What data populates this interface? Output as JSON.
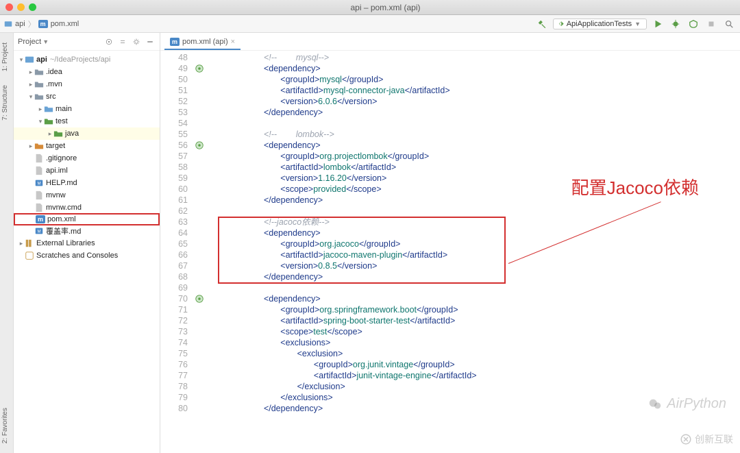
{
  "window": {
    "title": "api – pom.xml (api)"
  },
  "breadcrumb": {
    "project": "api",
    "file": "pom.xml"
  },
  "toolbar": {
    "run_config": "ApiApplicationTests",
    "hammer_title": "Build",
    "run_title": "Run",
    "debug_title": "Debug",
    "coverage_title": "Coverage",
    "stop_title": "Stop",
    "search_title": "Search"
  },
  "rail": {
    "project": "1: Project",
    "structure": "7: Structure",
    "favorites": "2: Favorites"
  },
  "sidebar": {
    "title": "Project",
    "items": [
      {
        "depth": 0,
        "tw": "▾",
        "icon": "module",
        "label": "api",
        "path": "~/IdeaProjects/api",
        "bold": true
      },
      {
        "depth": 1,
        "tw": "▸",
        "icon": "folder",
        "label": ".idea"
      },
      {
        "depth": 1,
        "tw": "▸",
        "icon": "folder",
        "label": ".mvn"
      },
      {
        "depth": 1,
        "tw": "▾",
        "icon": "folder",
        "label": "src"
      },
      {
        "depth": 2,
        "tw": "▸",
        "icon": "folder-src",
        "label": "main"
      },
      {
        "depth": 2,
        "tw": "▾",
        "icon": "folder-test",
        "label": "test"
      },
      {
        "depth": 3,
        "tw": "▸",
        "icon": "folder-test",
        "label": "java",
        "yellow": true
      },
      {
        "depth": 1,
        "tw": "▸",
        "icon": "folder-target",
        "label": "target"
      },
      {
        "depth": 1,
        "tw": "",
        "icon": "file",
        "label": ".gitignore"
      },
      {
        "depth": 1,
        "tw": "",
        "icon": "file",
        "label": "api.iml"
      },
      {
        "depth": 1,
        "tw": "",
        "icon": "md",
        "label": "HELP.md"
      },
      {
        "depth": 1,
        "tw": "",
        "icon": "file",
        "label": "mvnw"
      },
      {
        "depth": 1,
        "tw": "",
        "icon": "file",
        "label": "mvnw.cmd"
      },
      {
        "depth": 1,
        "tw": "",
        "icon": "maven",
        "label": "pom.xml",
        "selected": true
      },
      {
        "depth": 1,
        "tw": "",
        "icon": "md",
        "label": "覆盖率.md"
      },
      {
        "depth": 0,
        "tw": "▸",
        "icon": "lib",
        "label": "External Libraries"
      },
      {
        "depth": 0,
        "tw": "",
        "icon": "scratch",
        "label": "Scratches and Consoles"
      }
    ]
  },
  "editor": {
    "tab_label": "pom.xml (api)",
    "first_line_no": 48,
    "mark_lines": [
      49,
      56,
      70
    ],
    "lines": [
      {
        "n": 48,
        "i": 3,
        "t": "cmt",
        "raw": "<!--        mysql-->"
      },
      {
        "n": 49,
        "i": 3,
        "t": "open",
        "tag": "dependency"
      },
      {
        "n": 50,
        "i": 4,
        "t": "elem",
        "tag": "groupId",
        "text": "mysql"
      },
      {
        "n": 51,
        "i": 4,
        "t": "elem",
        "tag": "artifactId",
        "text": "mysql-connector-java"
      },
      {
        "n": 52,
        "i": 4,
        "t": "elem",
        "tag": "version",
        "text": "6.0.6"
      },
      {
        "n": 53,
        "i": 3,
        "t": "close",
        "tag": "dependency"
      },
      {
        "n": 54,
        "i": 0,
        "t": "blank"
      },
      {
        "n": 55,
        "i": 3,
        "t": "cmt",
        "raw": "<!--        lombok-->"
      },
      {
        "n": 56,
        "i": 3,
        "t": "open",
        "tag": "dependency"
      },
      {
        "n": 57,
        "i": 4,
        "t": "elem",
        "tag": "groupId",
        "text": "org.projectlombok"
      },
      {
        "n": 58,
        "i": 4,
        "t": "elem",
        "tag": "artifactId",
        "text": "lombok"
      },
      {
        "n": 59,
        "i": 4,
        "t": "elem",
        "tag": "version",
        "text": "1.16.20"
      },
      {
        "n": 60,
        "i": 4,
        "t": "elem",
        "tag": "scope",
        "text": "provided"
      },
      {
        "n": 61,
        "i": 3,
        "t": "close",
        "tag": "dependency"
      },
      {
        "n": 62,
        "i": 0,
        "t": "blank"
      },
      {
        "n": 63,
        "i": 3,
        "t": "cmt",
        "raw": "<!--jacoco依赖-->"
      },
      {
        "n": 64,
        "i": 3,
        "t": "open",
        "tag": "dependency"
      },
      {
        "n": 65,
        "i": 4,
        "t": "elem",
        "tag": "groupId",
        "text": "org.jacoco"
      },
      {
        "n": 66,
        "i": 4,
        "t": "elem",
        "tag": "artifactId",
        "text": "jacoco-maven-plugin"
      },
      {
        "n": 67,
        "i": 4,
        "t": "elem",
        "tag": "version",
        "text": "0.8.5"
      },
      {
        "n": 68,
        "i": 3,
        "t": "close",
        "tag": "dependency"
      },
      {
        "n": 69,
        "i": 0,
        "t": "blank"
      },
      {
        "n": 70,
        "i": 3,
        "t": "open",
        "tag": "dependency"
      },
      {
        "n": 71,
        "i": 4,
        "t": "elem",
        "tag": "groupId",
        "text": "org.springframework.boot"
      },
      {
        "n": 72,
        "i": 4,
        "t": "elem",
        "tag": "artifactId",
        "text": "spring-boot-starter-test"
      },
      {
        "n": 73,
        "i": 4,
        "t": "elem",
        "tag": "scope",
        "text": "test"
      },
      {
        "n": 74,
        "i": 4,
        "t": "open",
        "tag": "exclusions"
      },
      {
        "n": 75,
        "i": 5,
        "t": "open",
        "tag": "exclusion"
      },
      {
        "n": 76,
        "i": 6,
        "t": "elem",
        "tag": "groupId",
        "text": "org.junit.vintage"
      },
      {
        "n": 77,
        "i": 6,
        "t": "elem",
        "tag": "artifactId",
        "text": "junit-vintage-engine"
      },
      {
        "n": 78,
        "i": 5,
        "t": "close",
        "tag": "exclusion"
      },
      {
        "n": 79,
        "i": 4,
        "t": "close",
        "tag": "exclusions"
      },
      {
        "n": 80,
        "i": 3,
        "t": "close",
        "tag": "dependency"
      }
    ]
  },
  "annotation": {
    "label": "配置Jacoco依赖"
  },
  "watermarks": {
    "w1": "AirPython",
    "w2": "创新互联"
  }
}
